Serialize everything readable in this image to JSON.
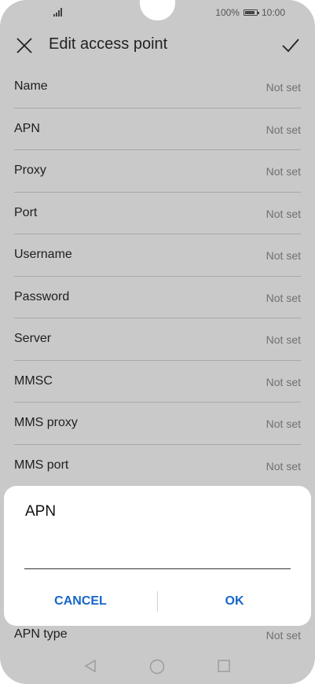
{
  "status_bar": {
    "battery_percent": "100%",
    "time": "10:00"
  },
  "appbar": {
    "title": "Edit access point",
    "close_icon": "close-icon",
    "confirm_icon": "check-icon"
  },
  "fields": [
    {
      "label": "Name",
      "value": "Not set"
    },
    {
      "label": "APN",
      "value": "Not set"
    },
    {
      "label": "Proxy",
      "value": "Not set"
    },
    {
      "label": "Port",
      "value": "Not set"
    },
    {
      "label": "Username",
      "value": "Not set"
    },
    {
      "label": "Password",
      "value": "Not set"
    },
    {
      "label": "Server",
      "value": "Not set"
    },
    {
      "label": "MMSC",
      "value": "Not set"
    },
    {
      "label": "MMS proxy",
      "value": "Not set"
    },
    {
      "label": "MMS port",
      "value": "Not set"
    }
  ],
  "apn_type": {
    "label": "APN type",
    "value": "Not set"
  },
  "dialog": {
    "title": "APN",
    "input_value": "",
    "cancel_label": "CANCEL",
    "ok_label": "OK"
  },
  "navbar": {
    "back_icon": "back-triangle-icon",
    "home_icon": "home-circle-icon",
    "recent_icon": "recents-square-icon"
  },
  "colors": {
    "overlay_background": "#c9c9c9",
    "accent": "#1766c9",
    "dialog_background": "#ffffff"
  }
}
